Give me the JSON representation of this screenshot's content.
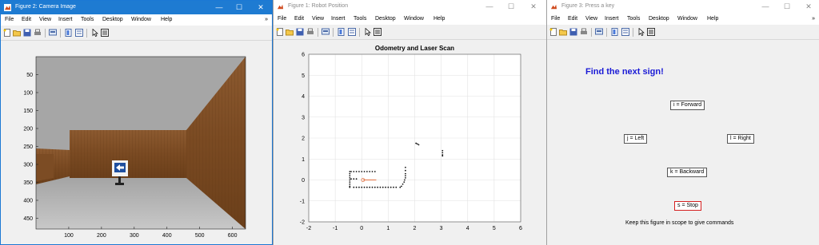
{
  "menu_items": [
    "File",
    "Edit",
    "View",
    "Insert",
    "Tools",
    "Desktop",
    "Window",
    "Help"
  ],
  "window_controls": {
    "minimize": "—",
    "maximize": "☐",
    "close": "✕"
  },
  "fig_camera": {
    "title": "Figure 2: Camera Image",
    "chart_data": {
      "type": "image",
      "x_ticks": [
        "100",
        "200",
        "300",
        "400",
        "500",
        "600"
      ],
      "y_ticks": [
        "50",
        "100",
        "150",
        "200",
        "250",
        "300",
        "350",
        "400",
        "450"
      ],
      "xlim": [
        0,
        640
      ],
      "ylim": [
        0,
        480
      ]
    }
  },
  "fig_robot": {
    "title": "Figure 1: Robot Position",
    "chart_data": {
      "type": "scatter",
      "title": "Odometry and Laser Scan",
      "xlim": [
        -2,
        6
      ],
      "ylim": [
        -2,
        6
      ],
      "x_ticks": [
        "-2",
        "-1",
        "0",
        "1",
        "2",
        "3",
        "4",
        "5",
        "6"
      ],
      "y_ticks": [
        "-2",
        "-1",
        "0",
        "1",
        "2",
        "3",
        "4",
        "5",
        "6"
      ],
      "grid": true,
      "robot": {
        "x": 0.05,
        "y": 0.0,
        "heading_line_end_x": 0.55,
        "color": "#e07040"
      },
      "scan_points": [
        [
          -0.45,
          0.4
        ],
        [
          -0.4,
          0.4
        ],
        [
          -0.3,
          0.4
        ],
        [
          -0.2,
          0.4
        ],
        [
          -0.1,
          0.4
        ],
        [
          0.0,
          0.4
        ],
        [
          0.1,
          0.4
        ],
        [
          0.2,
          0.4
        ],
        [
          0.3,
          0.4
        ],
        [
          0.4,
          0.4
        ],
        [
          0.5,
          0.4
        ],
        [
          -0.45,
          0.3
        ],
        [
          -0.45,
          0.2
        ],
        [
          -0.45,
          0.1
        ],
        [
          -0.45,
          0.0
        ],
        [
          -0.45,
          -0.1
        ],
        [
          -0.45,
          -0.2
        ],
        [
          -0.45,
          -0.3
        ],
        [
          -0.45,
          -0.35
        ],
        [
          -0.3,
          -0.35
        ],
        [
          -0.2,
          -0.35
        ],
        [
          -0.1,
          -0.35
        ],
        [
          0.0,
          -0.35
        ],
        [
          0.1,
          -0.35
        ],
        [
          0.2,
          -0.35
        ],
        [
          0.3,
          -0.35
        ],
        [
          0.4,
          -0.35
        ],
        [
          0.5,
          -0.35
        ],
        [
          0.6,
          -0.35
        ],
        [
          0.7,
          -0.35
        ],
        [
          0.8,
          -0.35
        ],
        [
          0.9,
          -0.35
        ],
        [
          1.0,
          -0.35
        ],
        [
          1.1,
          -0.35
        ],
        [
          1.2,
          -0.35
        ],
        [
          1.3,
          -0.35
        ],
        [
          1.45,
          -0.35
        ],
        [
          -0.4,
          0.05
        ],
        [
          -0.3,
          0.05
        ],
        [
          -0.2,
          0.05
        ],
        [
          1.5,
          -0.3
        ],
        [
          1.55,
          -0.2
        ],
        [
          1.6,
          -0.1
        ],
        [
          1.62,
          0.0
        ],
        [
          1.65,
          0.1
        ],
        [
          1.65,
          0.2
        ],
        [
          1.65,
          0.3
        ],
        [
          1.65,
          0.45
        ],
        [
          1.65,
          0.6
        ],
        [
          2.05,
          1.75
        ],
        [
          2.1,
          1.72
        ],
        [
          2.15,
          1.68
        ],
        [
          3.05,
          1.4
        ],
        [
          3.05,
          1.3
        ],
        [
          3.05,
          1.2
        ],
        [
          3.05,
          1.15
        ]
      ]
    }
  },
  "fig_keys": {
    "title": "Figure 3: Press a key",
    "heading": "Find the next sign!",
    "btn_forward": "i = Forward",
    "btn_left": "j = Left",
    "btn_right": "l = Right",
    "btn_backward": "k = Backward",
    "btn_stop": "s = Stop",
    "footer": "Keep this figure in scope to give commands"
  }
}
